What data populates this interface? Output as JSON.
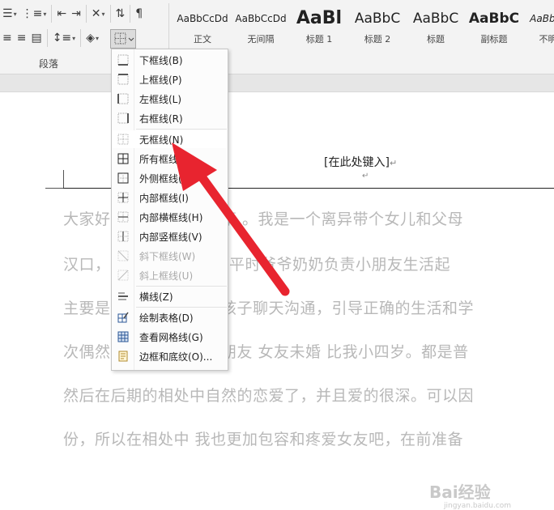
{
  "ribbon": {
    "group_label": "段落",
    "styles": [
      {
        "sample": "AaBbCcDd",
        "name": "正文"
      },
      {
        "sample": "AaBbCcDd",
        "name": "无间隔"
      },
      {
        "sample": "AaBl",
        "name": "标题 1"
      },
      {
        "sample": "AaBbC",
        "name": "标题 2"
      },
      {
        "sample": "AaBbC",
        "name": "标题"
      },
      {
        "sample": "AaBbC",
        "name": "副标题"
      },
      {
        "sample": "AaBbCcD",
        "name": "不明显"
      }
    ]
  },
  "document": {
    "header_text": "[在此处键入]",
    "pilcrow": "↵",
    "lines": [
      "大家好　　　　　的故事 。我是一个离异带个女儿和父母",
      "汉口，　　　　　年级，平时爷爷奶奶负责小朋友生活起",
      "主要是　　　　　业和孩子聊天沟通，引导正确的生活和学",
      "次偶然　　　　　在女朋友 女友未婚 比我小四岁。都是普",
      "然后在后期的相处中自然的恋爱了，并且爱的很深。可以因",
      "份，所以在相处中 我也更加包容和疼爱女友吧，在前准备"
    ]
  },
  "border_menu": {
    "items": [
      {
        "label": "下框线(B)",
        "icon": "bottom-border-icon",
        "disabled": false
      },
      {
        "label": "上框线(P)",
        "icon": "top-border-icon",
        "disabled": false
      },
      {
        "label": "左框线(L)",
        "icon": "left-border-icon",
        "disabled": false
      },
      {
        "label": "右框线(R)",
        "icon": "right-border-icon",
        "disabled": false
      },
      {
        "label": "无框线(N)",
        "icon": "no-border-icon",
        "disabled": false
      },
      {
        "label": "所有框线(A)",
        "icon": "all-borders-icon",
        "disabled": false
      },
      {
        "label": "外侧框线(S)",
        "icon": "outside-borders-icon",
        "disabled": false
      },
      {
        "label": "内部框线(I)",
        "icon": "inside-borders-icon",
        "disabled": false
      },
      {
        "label": "内部横框线(H)",
        "icon": "inside-horizontal-border-icon",
        "disabled": false
      },
      {
        "label": "内部竖框线(V)",
        "icon": "inside-vertical-border-icon",
        "disabled": false
      },
      {
        "label": "斜下框线(W)",
        "icon": "diagonal-down-border-icon",
        "disabled": true
      },
      {
        "label": "斜上框线(U)",
        "icon": "diagonal-up-border-icon",
        "disabled": true
      },
      {
        "label": "横线(Z)",
        "icon": "horizontal-line-icon",
        "disabled": false
      },
      {
        "label": "绘制表格(D)",
        "icon": "draw-table-icon",
        "disabled": false
      },
      {
        "label": "查看网格线(G)",
        "icon": "view-gridlines-icon",
        "disabled": false
      },
      {
        "label": "边框和底纹(O)...",
        "icon": "borders-shading-icon",
        "disabled": false
      }
    ]
  },
  "annotation": {
    "arrow_color": "#e8242f"
  },
  "watermark": {
    "text": "Bai经验",
    "sub": "jingyan.baidu.com"
  }
}
